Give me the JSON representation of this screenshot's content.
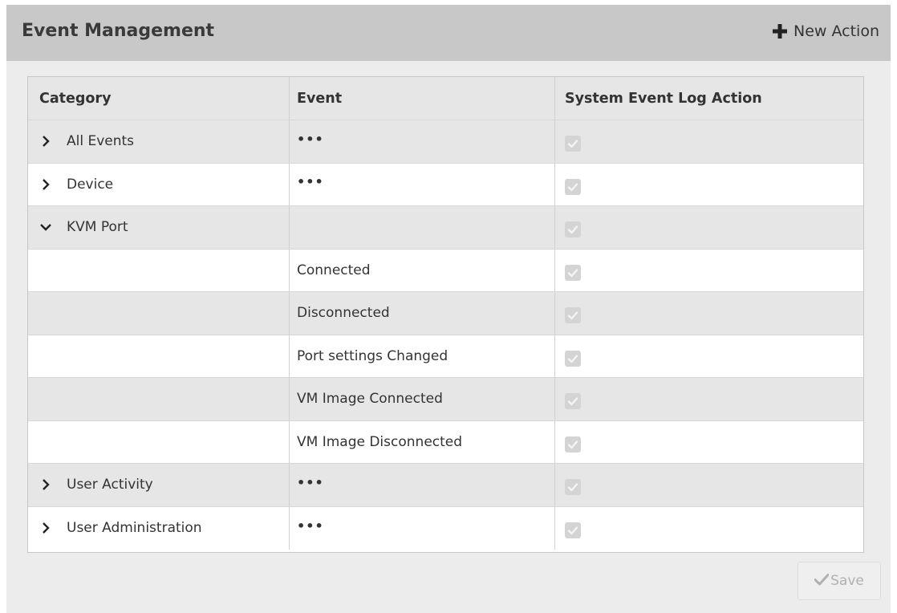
{
  "header": {
    "title": "Event Management",
    "new_action_label": "New Action"
  },
  "table": {
    "columns": [
      "Category",
      "Event",
      "System Event Log Action"
    ],
    "rows": [
      {
        "category": "All Events",
        "expander": "collapsed",
        "event": "•••",
        "checked": true,
        "enabled": false
      },
      {
        "category": "Device",
        "expander": "collapsed",
        "event": "•••",
        "checked": true,
        "enabled": false
      },
      {
        "category": "KVM Port",
        "expander": "expanded",
        "event": "",
        "checked": true,
        "enabled": false
      },
      {
        "category": "",
        "expander": "none",
        "event": "Connected",
        "checked": true,
        "enabled": false
      },
      {
        "category": "",
        "expander": "none",
        "event": "Disconnected",
        "checked": true,
        "enabled": false
      },
      {
        "category": "",
        "expander": "none",
        "event": "Port settings Changed",
        "checked": true,
        "enabled": false
      },
      {
        "category": "",
        "expander": "none",
        "event": "VM Image Connected",
        "checked": true,
        "enabled": false
      },
      {
        "category": "",
        "expander": "none",
        "event": "VM Image Disconnected",
        "checked": true,
        "enabled": false
      },
      {
        "category": "User Activity",
        "expander": "collapsed",
        "event": "•••",
        "checked": true,
        "enabled": false
      },
      {
        "category": "User Administration",
        "expander": "collapsed",
        "event": "•••",
        "checked": true,
        "enabled": false
      }
    ]
  },
  "footer": {
    "save_label": "Save",
    "save_enabled": false
  },
  "colors": {
    "header_bg": "#c8c8c8",
    "panel_bg": "#ececec",
    "row_alt_bg": "#e6e6e6",
    "checkbox_disabled": "#d4d4d4"
  }
}
